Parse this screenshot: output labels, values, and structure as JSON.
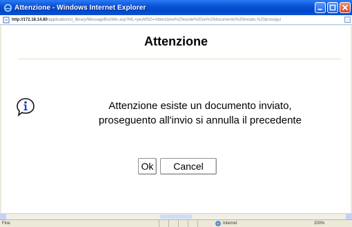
{
  "window": {
    "title": "Attenzione - Windows Internet Explorer"
  },
  "address_bar": {
    "url_host": "http://172.18.14.80",
    "url_rest": "/application/cl_library/MessageBoxWin.asp?ML=yesMSG=Attenzione%20esiste%20un%20documento%20inviato,%20prosegui"
  },
  "dialog": {
    "title": "Attenzione",
    "message_line1": "Attenzione esiste un documento inviato,",
    "message_line2": "proseguento all'invio si annulla il precedente",
    "ok_label": "Ok",
    "cancel_label": "Cancel"
  },
  "status_bar": {
    "left_text": "Fine",
    "zone_text": "Internet",
    "zoom_text": "200%"
  },
  "colors": {
    "titlebar": "#0a53d8",
    "info_icon": "#1a3cc8"
  }
}
